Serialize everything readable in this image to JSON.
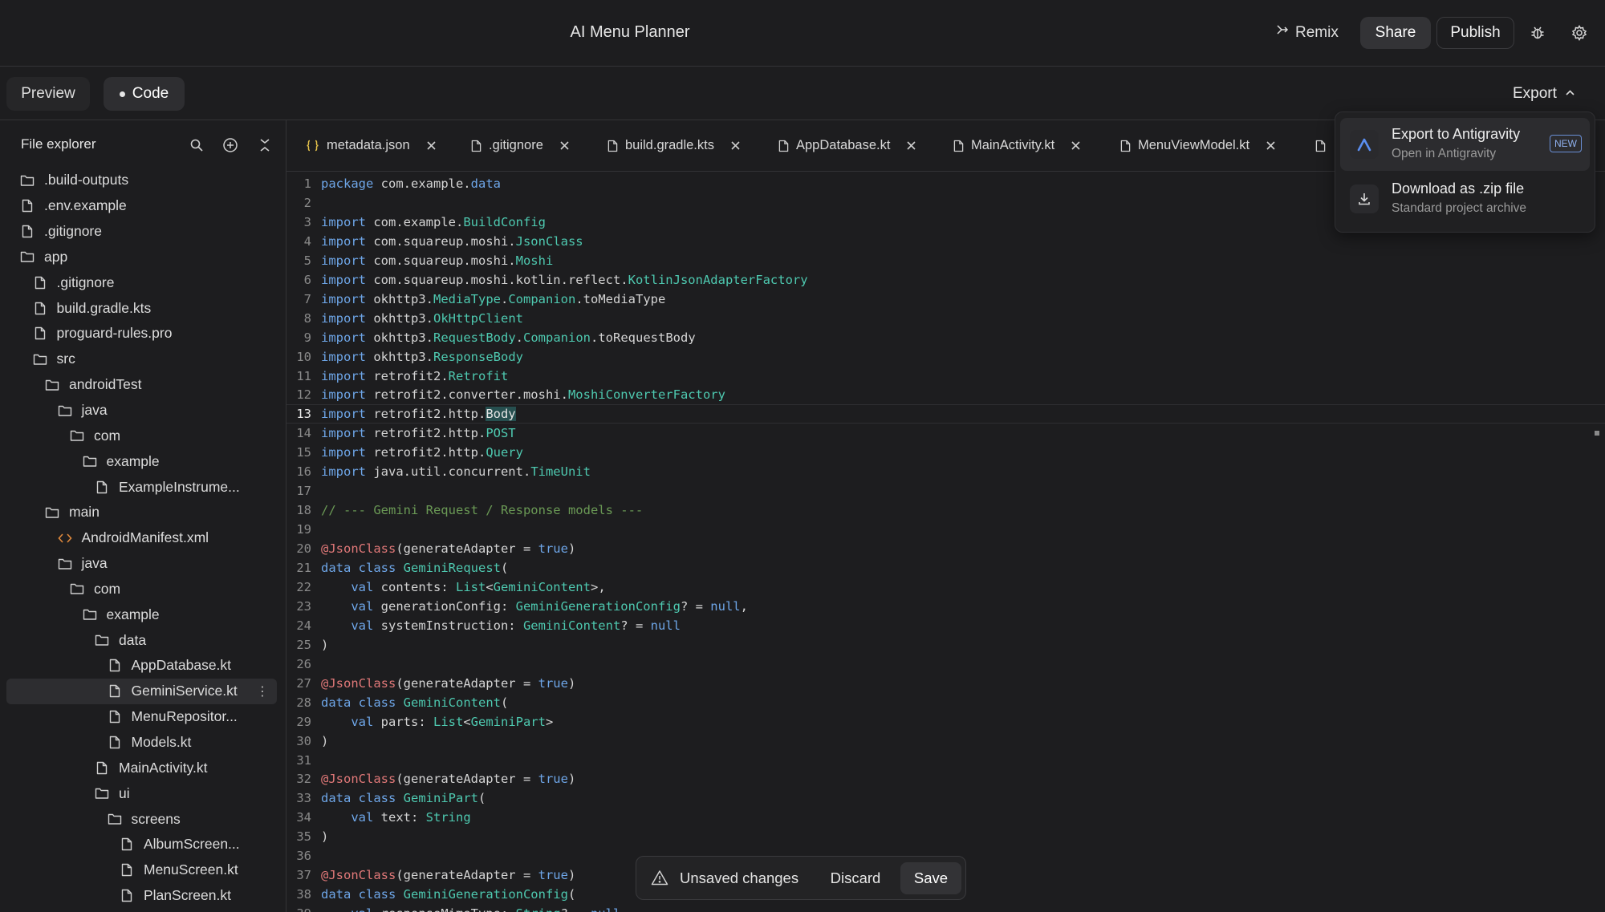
{
  "header": {
    "title": "AI Menu Planner",
    "remix_label": "Remix",
    "share_label": "Share",
    "publish_label": "Publish",
    "icons": [
      "remix-icon",
      "bug-icon",
      "gear-icon"
    ]
  },
  "modes": {
    "preview_label": "Preview",
    "code_label": "Code",
    "active": "Code",
    "export_label": "Export"
  },
  "export_menu": {
    "items": [
      {
        "title": "Export to Antigravity",
        "subtitle": "Open in Antigravity",
        "badge": "NEW",
        "icon": "antigravity-icon"
      },
      {
        "title": "Download as .zip file",
        "subtitle": "Standard project archive",
        "icon": "download-icon"
      }
    ]
  },
  "file_explorer": {
    "title": "File explorer",
    "icons": [
      "search-icon",
      "add-icon",
      "collapse-icon"
    ],
    "items": [
      {
        "name": ".build-outputs",
        "type": "folder",
        "depth": 0
      },
      {
        "name": ".env.example",
        "type": "file",
        "depth": 0
      },
      {
        "name": ".gitignore",
        "type": "file",
        "depth": 0
      },
      {
        "name": "app",
        "type": "folder",
        "depth": 0
      },
      {
        "name": ".gitignore",
        "type": "file",
        "depth": 1
      },
      {
        "name": "build.gradle.kts",
        "type": "file",
        "depth": 1
      },
      {
        "name": "proguard-rules.pro",
        "type": "file",
        "depth": 1
      },
      {
        "name": "src",
        "type": "folder",
        "depth": 1
      },
      {
        "name": "androidTest",
        "type": "folder",
        "depth": 2
      },
      {
        "name": "java",
        "type": "folder",
        "depth": 3
      },
      {
        "name": "com",
        "type": "folder",
        "depth": 4
      },
      {
        "name": "example",
        "type": "folder",
        "depth": 5
      },
      {
        "name": "ExampleInstrume...",
        "type": "file",
        "depth": 6
      },
      {
        "name": "main",
        "type": "folder",
        "depth": 2
      },
      {
        "name": "AndroidManifest.xml",
        "type": "xml",
        "depth": 3
      },
      {
        "name": "java",
        "type": "folder",
        "depth": 3
      },
      {
        "name": "com",
        "type": "folder",
        "depth": 4
      },
      {
        "name": "example",
        "type": "folder",
        "depth": 5
      },
      {
        "name": "data",
        "type": "folder",
        "depth": 6
      },
      {
        "name": "AppDatabase.kt",
        "type": "file",
        "depth": 7
      },
      {
        "name": "GeminiService.kt",
        "type": "file",
        "depth": 7,
        "selected": true
      },
      {
        "name": "MenuRepositor...",
        "type": "file",
        "depth": 7
      },
      {
        "name": "Models.kt",
        "type": "file",
        "depth": 7
      },
      {
        "name": "MainActivity.kt",
        "type": "file",
        "depth": 6
      },
      {
        "name": "ui",
        "type": "folder",
        "depth": 6
      },
      {
        "name": "screens",
        "type": "folder",
        "depth": 7
      },
      {
        "name": "AlbumScreen...",
        "type": "file",
        "depth": 8
      },
      {
        "name": "MenuScreen.kt",
        "type": "file",
        "depth": 8
      },
      {
        "name": "PlanScreen.kt",
        "type": "file",
        "depth": 8
      }
    ]
  },
  "tabs": [
    {
      "label": "metadata.json",
      "icon": "json-icon"
    },
    {
      "label": ".gitignore",
      "icon": "file-icon"
    },
    {
      "label": "build.gradle.kts",
      "icon": "file-icon"
    },
    {
      "label": "AppDatabase.kt",
      "icon": "file-icon"
    },
    {
      "label": "MainActivity.kt",
      "icon": "file-icon"
    },
    {
      "label": "MenuViewModel.kt",
      "icon": "file-icon"
    }
  ],
  "editor": {
    "active_line": 13,
    "lines": [
      [
        [
          "kw",
          "package"
        ],
        [
          "pl",
          " com.example."
        ],
        [
          "kw",
          "data"
        ]
      ],
      [],
      [
        [
          "kw",
          "import"
        ],
        [
          "pl",
          " com.example."
        ],
        [
          "ty",
          "BuildConfig"
        ]
      ],
      [
        [
          "kw",
          "import"
        ],
        [
          "pl",
          " com.squareup.moshi."
        ],
        [
          "ty",
          "JsonClass"
        ]
      ],
      [
        [
          "kw",
          "import"
        ],
        [
          "pl",
          " com.squareup.moshi."
        ],
        [
          "ty",
          "Moshi"
        ]
      ],
      [
        [
          "kw",
          "import"
        ],
        [
          "pl",
          " com.squareup.moshi.kotlin.reflect."
        ],
        [
          "ty",
          "KotlinJsonAdapterFactory"
        ]
      ],
      [
        [
          "kw",
          "import"
        ],
        [
          "pl",
          " okhttp3."
        ],
        [
          "ty",
          "MediaType"
        ],
        [
          "pl",
          "."
        ],
        [
          "ty",
          "Companion"
        ],
        [
          "pl",
          ".toMediaType"
        ]
      ],
      [
        [
          "kw",
          "import"
        ],
        [
          "pl",
          " okhttp3."
        ],
        [
          "ty",
          "OkHttpClient"
        ]
      ],
      [
        [
          "kw",
          "import"
        ],
        [
          "pl",
          " okhttp3."
        ],
        [
          "ty",
          "RequestBody"
        ],
        [
          "pl",
          "."
        ],
        [
          "ty",
          "Companion"
        ],
        [
          "pl",
          ".toRequestBody"
        ]
      ],
      [
        [
          "kw",
          "import"
        ],
        [
          "pl",
          " okhttp3."
        ],
        [
          "ty",
          "ResponseBody"
        ]
      ],
      [
        [
          "kw",
          "import"
        ],
        [
          "pl",
          " retrofit2."
        ],
        [
          "ty",
          "Retrofit"
        ]
      ],
      [
        [
          "kw",
          "import"
        ],
        [
          "pl",
          " retrofit2.converter.moshi."
        ],
        [
          "ty",
          "MoshiConverterFactory"
        ]
      ],
      [
        [
          "kw",
          "import"
        ],
        [
          "pl",
          " retrofit2.http."
        ],
        [
          "hl",
          "Body"
        ]
      ],
      [
        [
          "kw",
          "import"
        ],
        [
          "pl",
          " retrofit2.http."
        ],
        [
          "ty",
          "POST"
        ]
      ],
      [
        [
          "kw",
          "import"
        ],
        [
          "pl",
          " retrofit2.http."
        ],
        [
          "ty",
          "Query"
        ]
      ],
      [
        [
          "kw",
          "import"
        ],
        [
          "pl",
          " java.util.concurrent."
        ],
        [
          "ty",
          "TimeUnit"
        ]
      ],
      [],
      [
        [
          "cm",
          "// --- Gemini Request / Response models ---"
        ]
      ],
      [],
      [
        [
          "an",
          "@JsonClass"
        ],
        [
          "pl",
          "(generateAdapter = "
        ],
        [
          "kw",
          "true"
        ],
        [
          "pl",
          ")"
        ]
      ],
      [
        [
          "kw",
          "data class"
        ],
        [
          "pl",
          " "
        ],
        [
          "ty",
          "GeminiRequest"
        ],
        [
          "pl",
          "("
        ]
      ],
      [
        [
          "pl",
          "    "
        ],
        [
          "kw",
          "val"
        ],
        [
          "pl",
          " contents: "
        ],
        [
          "ty",
          "List"
        ],
        [
          "pl",
          "<"
        ],
        [
          "ty",
          "GeminiContent"
        ],
        [
          "pl",
          ">,"
        ]
      ],
      [
        [
          "pl",
          "    "
        ],
        [
          "kw",
          "val"
        ],
        [
          "pl",
          " generationConfig: "
        ],
        [
          "ty",
          "GeminiGenerationConfig"
        ],
        [
          "pl",
          "? = "
        ],
        [
          "kw",
          "null"
        ],
        [
          "pl",
          ","
        ]
      ],
      [
        [
          "pl",
          "    "
        ],
        [
          "kw",
          "val"
        ],
        [
          "pl",
          " systemInstruction: "
        ],
        [
          "ty",
          "GeminiContent"
        ],
        [
          "pl",
          "? = "
        ],
        [
          "kw",
          "null"
        ]
      ],
      [
        [
          "pl",
          ")"
        ]
      ],
      [],
      [
        [
          "an",
          "@JsonClass"
        ],
        [
          "pl",
          "(generateAdapter = "
        ],
        [
          "kw",
          "true"
        ],
        [
          "pl",
          ")"
        ]
      ],
      [
        [
          "kw",
          "data class"
        ],
        [
          "pl",
          " "
        ],
        [
          "ty",
          "GeminiContent"
        ],
        [
          "pl",
          "("
        ]
      ],
      [
        [
          "pl",
          "    "
        ],
        [
          "kw",
          "val"
        ],
        [
          "pl",
          " parts: "
        ],
        [
          "ty",
          "List"
        ],
        [
          "pl",
          "<"
        ],
        [
          "ty",
          "GeminiPart"
        ],
        [
          "pl",
          ">"
        ]
      ],
      [
        [
          "pl",
          ")"
        ]
      ],
      [],
      [
        [
          "an",
          "@JsonClass"
        ],
        [
          "pl",
          "(generateAdapter = "
        ],
        [
          "kw",
          "true"
        ],
        [
          "pl",
          ")"
        ]
      ],
      [
        [
          "kw",
          "data class"
        ],
        [
          "pl",
          " "
        ],
        [
          "ty",
          "GeminiPart"
        ],
        [
          "pl",
          "("
        ]
      ],
      [
        [
          "pl",
          "    "
        ],
        [
          "kw",
          "val"
        ],
        [
          "pl",
          " text: "
        ],
        [
          "ty",
          "String"
        ]
      ],
      [
        [
          "pl",
          ")"
        ]
      ],
      [],
      [
        [
          "an",
          "@JsonClass"
        ],
        [
          "pl",
          "(generateAdapter = "
        ],
        [
          "kw",
          "true"
        ],
        [
          "pl",
          ")"
        ]
      ],
      [
        [
          "kw",
          "data class"
        ],
        [
          "pl",
          " "
        ],
        [
          "ty",
          "GeminiGenerationConfig"
        ],
        [
          "pl",
          "("
        ]
      ],
      [
        [
          "pl",
          "    "
        ],
        [
          "kw",
          "val"
        ],
        [
          "pl",
          " responseMimeType: "
        ],
        [
          "ty",
          "String"
        ],
        [
          "pl",
          "? = "
        ],
        [
          "kw",
          "null"
        ]
      ]
    ]
  },
  "save_bar": {
    "message": "Unsaved changes",
    "discard_label": "Discard",
    "save_label": "Save"
  }
}
